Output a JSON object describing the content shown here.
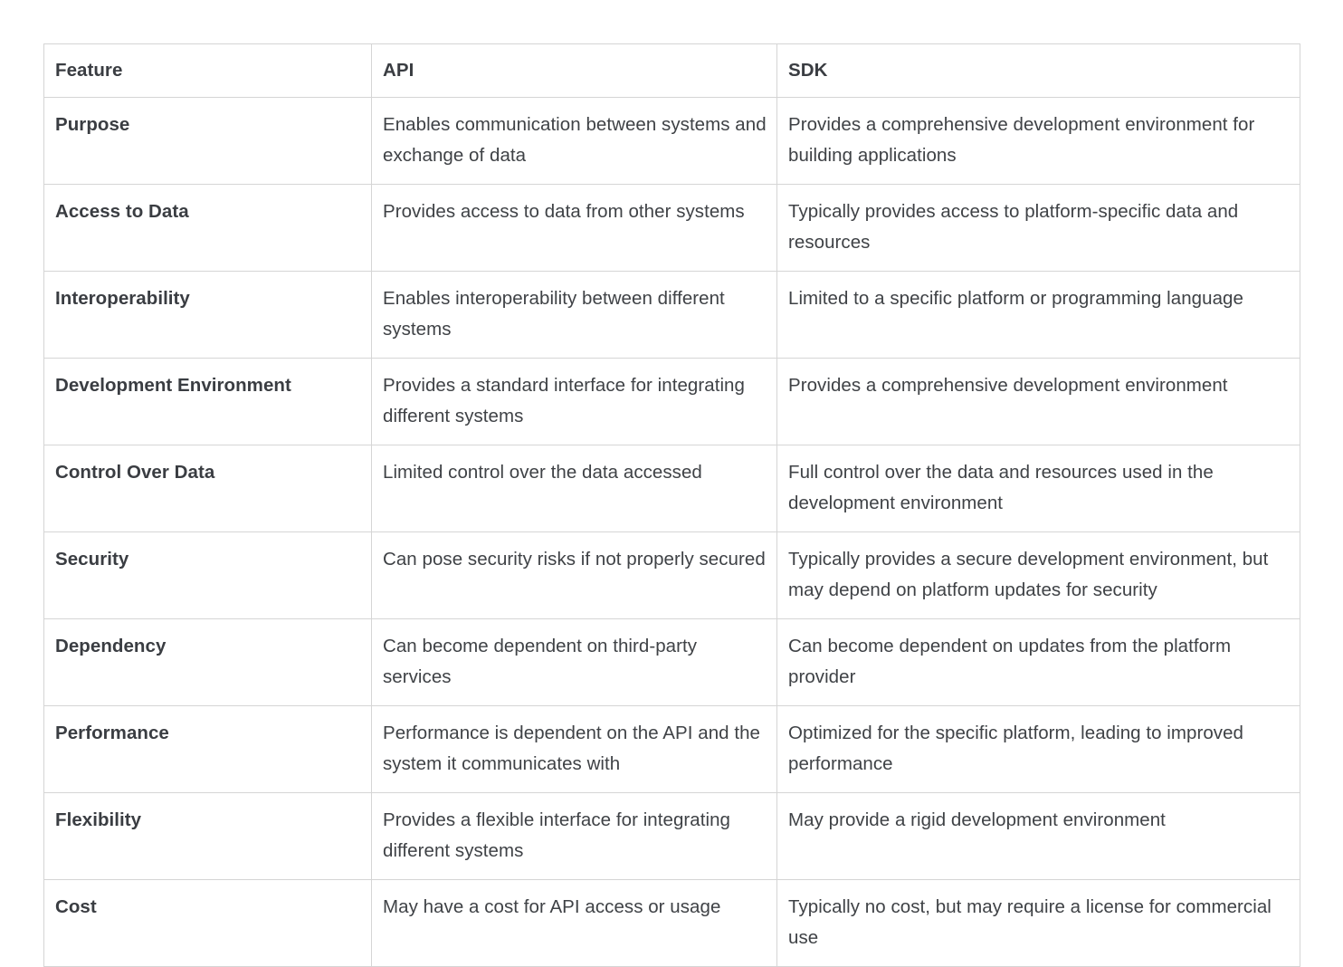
{
  "table": {
    "columns": [
      "Feature",
      "API",
      "SDK"
    ],
    "rows": [
      {
        "feature": "Purpose",
        "api": "Enables communication between systems and exchange of data",
        "sdk": "Provides a comprehensive development environment for building applications"
      },
      {
        "feature": "Access to Data",
        "api": "Provides access to data from other systems",
        "sdk": "Typically provides access to platform-specific data and resources"
      },
      {
        "feature": "Interoperability",
        "api": "Enables interoperability between different systems",
        "sdk": "Limited to a specific platform or programming language"
      },
      {
        "feature": "Development Environment",
        "api": "Provides a standard interface for integrating different systems",
        "sdk": "Provides a comprehensive development environment"
      },
      {
        "feature": "Control Over Data",
        "api": "Limited control over the data accessed",
        "sdk": "Full control over the data and resources used in the development environment"
      },
      {
        "feature": "Security",
        "api": "Can pose security risks if not properly secured",
        "sdk": "Typically provides a secure development environment, but may depend on platform updates for security"
      },
      {
        "feature": "Dependency",
        "api": "Can become dependent on third-party services",
        "sdk": "Can become dependent on updates from the platform provider"
      },
      {
        "feature": "Performance",
        "api": "Performance is dependent on the API and the system it communicates with",
        "sdk": "Optimized for the specific platform, leading to improved performance"
      },
      {
        "feature": "Flexibility",
        "api": "Provides a flexible interface for integrating different systems",
        "sdk": "May provide a rigid development environment"
      },
      {
        "feature": "Cost",
        "api": "May have a cost for API access or usage",
        "sdk": "Typically no cost, but may require a license for commercial use"
      }
    ]
  },
  "colors": {
    "border": "#d5d5d5",
    "text": "#3f4246",
    "heading_text": "#3a3d42",
    "background": "#ffffff"
  }
}
